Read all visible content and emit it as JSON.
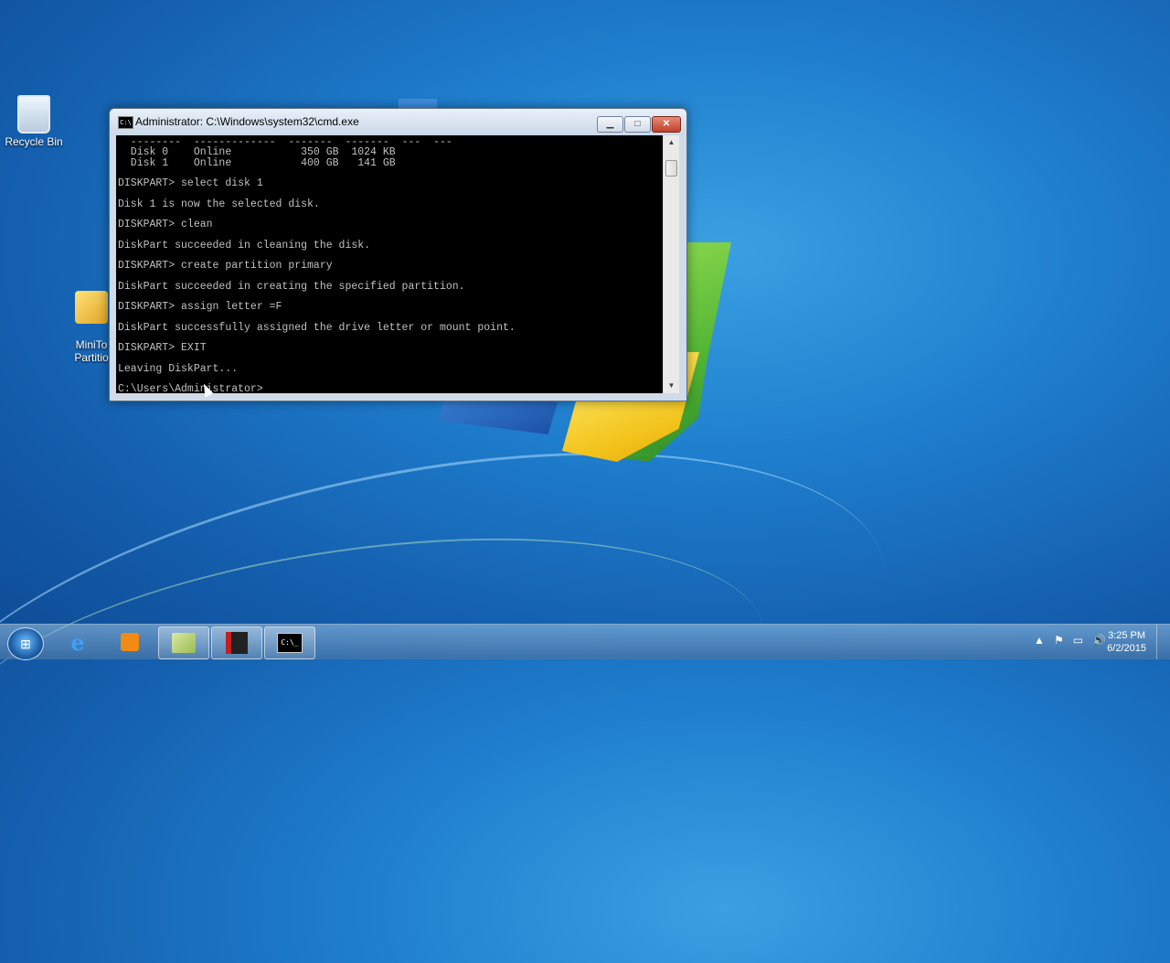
{
  "desktop": {
    "icons": [
      {
        "label": "Recycle Bin"
      },
      {
        "label": "MiniTo\nPartitio"
      }
    ]
  },
  "window": {
    "title": "Administrator: C:\\Windows\\system32\\cmd.exe",
    "icon_text": "C:\\",
    "controls": {
      "minimize": "▁",
      "maximize": "□",
      "close": "✕"
    },
    "console_lines": [
      "  --------  -------------  -------  -------  ---  ---",
      "  Disk 0    Online           350 GB  1024 KB",
      "  Disk 1    Online           400 GB   141 GB",
      "",
      "DISKPART> select disk 1",
      "",
      "Disk 1 is now the selected disk.",
      "",
      "DISKPART> clean",
      "",
      "DiskPart succeeded in cleaning the disk.",
      "",
      "DISKPART> create partition primary",
      "",
      "DiskPart succeeded in creating the specified partition.",
      "",
      "DISKPART> assign letter =F",
      "",
      "DiskPart successfully assigned the drive letter or mount point.",
      "",
      "DISKPART> EXIT",
      "",
      "Leaving DiskPart...",
      "",
      "C:\\Users\\Administrator>"
    ]
  },
  "taskbar": {
    "start_label": "⊞",
    "items": [
      {
        "name": "internet-explorer",
        "glyph": "e"
      },
      {
        "name": "media-player",
        "glyph": ""
      },
      {
        "name": "notes",
        "glyph": ""
      },
      {
        "name": "camera-app",
        "glyph": ""
      },
      {
        "name": "command-prompt",
        "glyph": "C:\\_",
        "active": true
      }
    ],
    "tray": {
      "icons": [
        "▲",
        "⚑",
        "▭",
        "🔊"
      ]
    },
    "clock": {
      "time": "3:25 PM",
      "date": "6/2/2015"
    }
  }
}
